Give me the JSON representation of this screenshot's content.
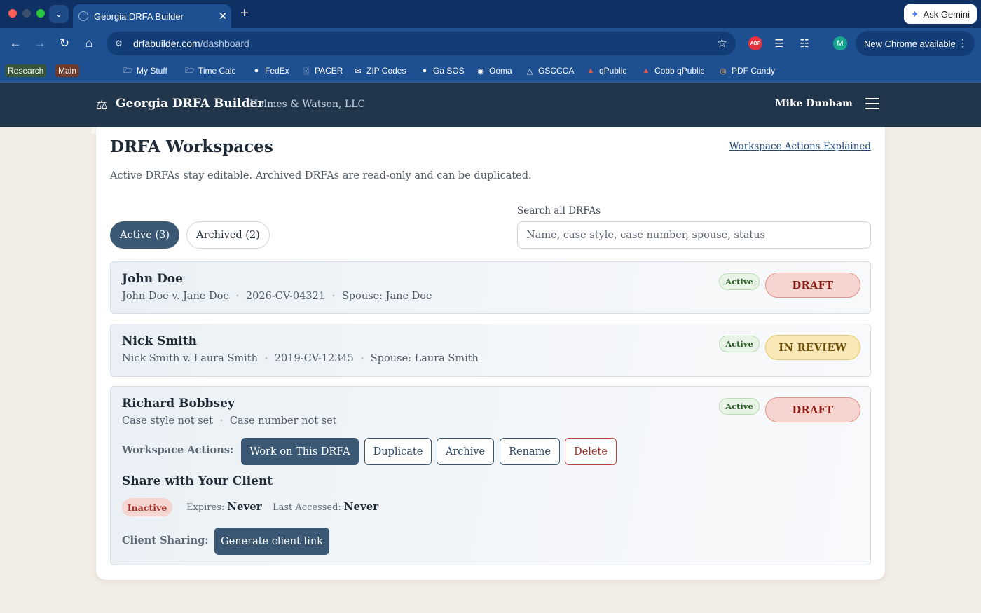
{
  "browser": {
    "tab_title": "Georgia DRFA Builder",
    "new_tab": "+",
    "ask_gemini": "Ask Gemini",
    "url_host": "drfabuilder.com",
    "url_path": "/dashboard",
    "update_label": "New Chrome available",
    "profile_initial": "M",
    "extensions": [
      "abp-icon",
      "layers-icon",
      "puzzle-icon"
    ],
    "bookmark_groups": [
      {
        "label": "Research",
        "color": "#37553a"
      },
      {
        "label": "Main",
        "color": "#6b3a2a"
      }
    ],
    "bookmarks": [
      {
        "label": "My Stuff",
        "icon": "folder-icon"
      },
      {
        "label": "Time Calc",
        "icon": "folder-icon"
      },
      {
        "label": "FedEx",
        "icon": "globe-icon"
      },
      {
        "label": "PACER",
        "icon": "columns-icon"
      },
      {
        "label": "ZIP Codes",
        "icon": "mail-icon"
      },
      {
        "label": "Ga SOS",
        "icon": "globe-icon"
      },
      {
        "label": "Ooma",
        "icon": "circle-icon"
      },
      {
        "label": "GSCCCA",
        "icon": "triangle-icon"
      },
      {
        "label": "qPublic",
        "icon": "q-icon"
      },
      {
        "label": "Cobb qPublic",
        "icon": "q-icon"
      },
      {
        "label": "PDF Candy",
        "icon": "candy-icon"
      }
    ]
  },
  "header": {
    "brand": "Georgia DRFA Builder",
    "firm": "Holmes & Watson, LLC",
    "user": "Mike Dunham"
  },
  "main": {
    "title": "DRFA Workspaces",
    "help_link": "Workspace Actions Explained",
    "subtitle": "Active DRFAs stay editable. Archived DRFAs are read-only and can be duplicated.",
    "filters": {
      "active": "Active (3)",
      "archived": "Archived (2)"
    },
    "search": {
      "label": "Search all DRFAs",
      "placeholder": "Name, case style, case number, spouse, status"
    },
    "items": [
      {
        "name": "John Doe",
        "meta": [
          "John Doe v. Jane Doe",
          "2026-CV-04321",
          "Spouse: Jane Doe"
        ],
        "badge": "Active",
        "status": "DRAFT"
      },
      {
        "name": "Nick Smith",
        "meta": [
          "Nick Smith v. Laura Smith",
          "2019-CV-12345",
          "Spouse: Laura Smith"
        ],
        "badge": "Active",
        "status": "IN REVIEW"
      },
      {
        "name": "Richard Bobbsey",
        "meta": [
          "Case style not set",
          "Case number not set"
        ],
        "badge": "Active",
        "status": "DRAFT"
      }
    ],
    "actions": {
      "label": "Workspace Actions:",
      "work": "Work on This DRFA",
      "duplicate": "Duplicate",
      "archive": "Archive",
      "rename": "Rename",
      "delete": "Delete"
    },
    "share": {
      "title": "Share with Your Client",
      "status": "Inactive",
      "expires_label": "Expires:",
      "expires_value": "Never",
      "accessed_label": "Last Accessed:",
      "accessed_value": "Never",
      "client_label": "Client Sharing:",
      "generate": "Generate client link"
    }
  },
  "colors": {
    "chrome_dark": "#0f3063",
    "chrome": "#1d4f91",
    "appbar": "#22364b",
    "primary": "#3a5873",
    "draft_bg": "#f6d4cf",
    "review_bg": "#f8e8b8",
    "active_bg": "#e8f5e6",
    "danger": "#a3312a"
  }
}
